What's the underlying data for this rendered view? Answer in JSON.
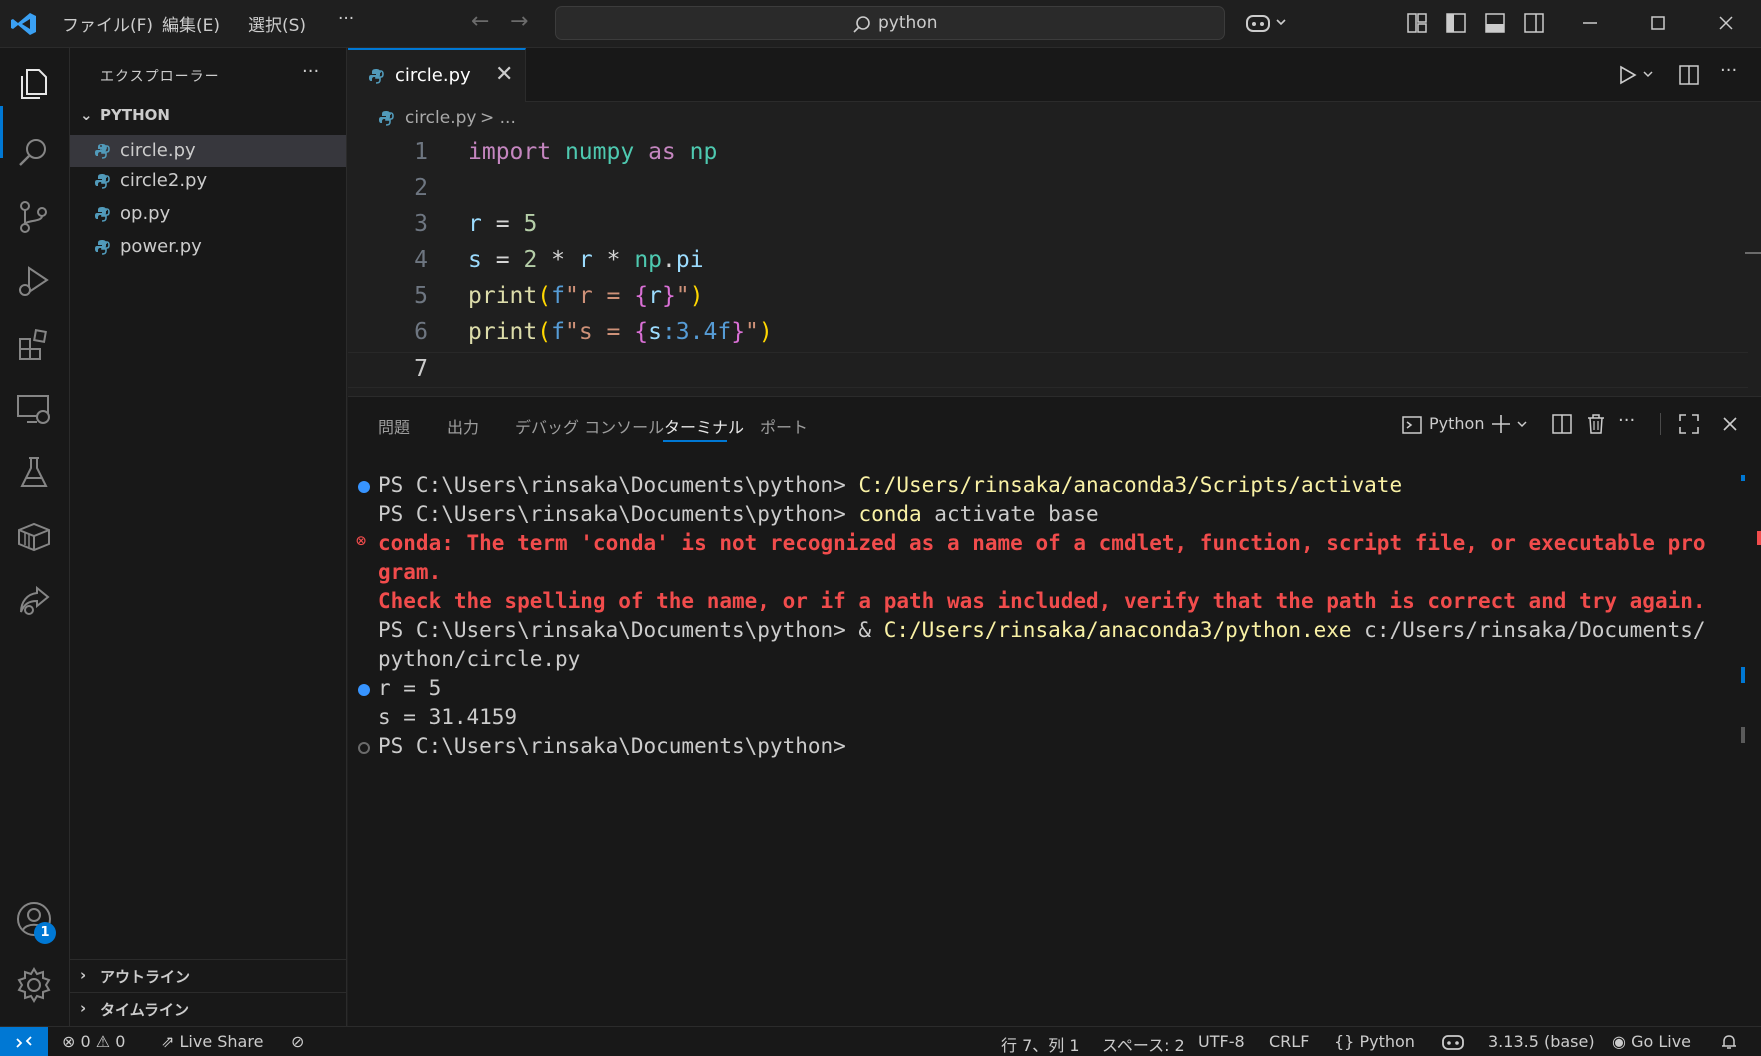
{
  "titlebar": {
    "menus": [
      "ファイル(F)",
      "編集(E)",
      "選択(S)",
      "···"
    ],
    "search_text": "python"
  },
  "activity": {
    "items": [
      "explorer-icon",
      "search-icon",
      "source-control-icon",
      "run-debug-icon",
      "extensions-icon",
      "remote-explorer-icon",
      "testing-icon",
      "containers-icon",
      "live-share-icon"
    ],
    "accounts_badge": "1"
  },
  "sidebar": {
    "title": "エクスプローラー",
    "more": "···",
    "folder": "PYTHON",
    "files": [
      "circle.py",
      "circle2.py",
      "op.py",
      "power.py"
    ],
    "outline": "アウトライン",
    "timeline": "タイムライン"
  },
  "editor": {
    "tab_label": "circle.py",
    "breadcrumb_file": "circle.py",
    "breadcrumb_more": "> ...",
    "line_numbers": [
      "1",
      "2",
      "3",
      "4",
      "5",
      "6",
      "7"
    ]
  },
  "panel": {
    "tabs": [
      "問題",
      "出力",
      "デバッグ コンソール",
      "ターミナル",
      "ポート"
    ],
    "active_tab": "ターミナル",
    "terminal_name": "Python",
    "terminal": {
      "l1_prompt": "PS C:\\Users\\rinsaka\\Documents\\python> ",
      "l1_cmd": "C:/Users/rinsaka/anaconda3/Scripts/activate",
      "l2_prompt": "PS C:\\Users\\rinsaka\\Documents\\python> ",
      "l2_cmd_a": "conda",
      "l2_cmd_b": " activate base",
      "err1": "conda: The term 'conda' is not recognized as a name of a cmdlet, function, script file, or executable pro",
      "err2": "gram.",
      "err3": "Check the spelling of the name, or if a path was included, verify that the path is correct and try again.",
      "l4_prompt": "PS C:\\Users\\rinsaka\\Documents\\python> & ",
      "l4_exe": "C:/Users/rinsaka/anaconda3/python.exe",
      "l4_arg": " c:/Users/rinsaka/Documents/",
      "l5": "python/circle.py",
      "out1": "r = 5",
      "out2": "s = 31.4159",
      "l8_prompt": "PS C:\\Users\\rinsaka\\Documents\\python>"
    }
  },
  "statusbar": {
    "errors": "0",
    "warnings": "0",
    "live_share": "Live Share",
    "position": "行 7、列 1",
    "spaces": "スペース: 2",
    "encoding": "UTF-8",
    "eol": "CRLF",
    "language": "Python",
    "interpreter": "3.13.5 (base)",
    "go_live": "Go Live"
  },
  "colors": {
    "accent": "#0078d4",
    "error": "#f14c4c",
    "terminal_yellow": "#f9f1a5"
  }
}
